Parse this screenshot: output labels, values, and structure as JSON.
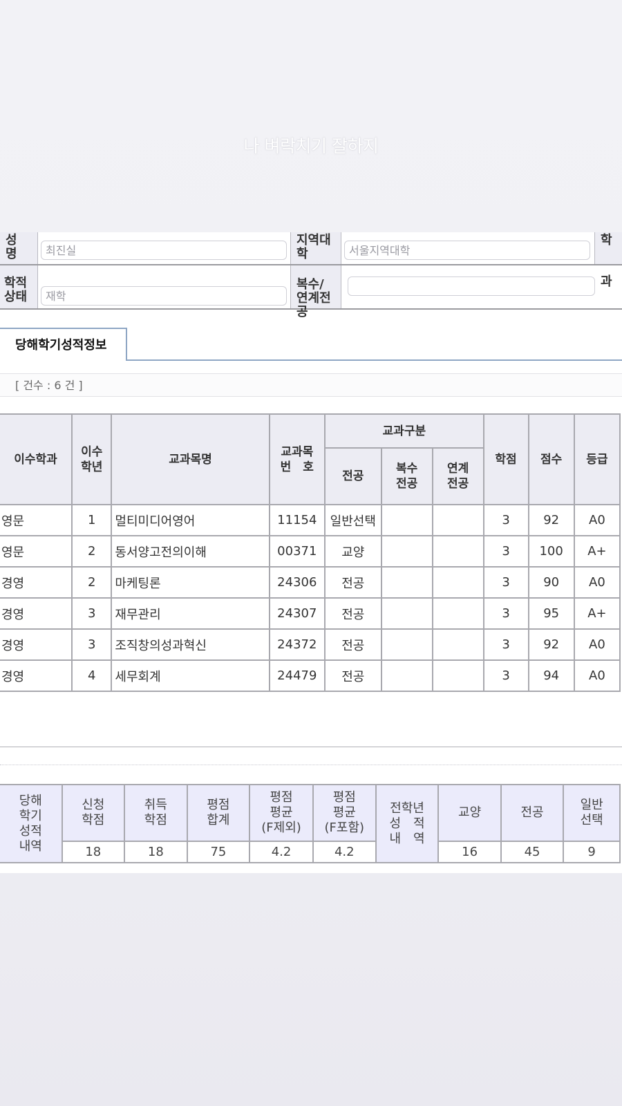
{
  "overlay_text": "나 벼락치기 잘하지",
  "student_info": {
    "name_label": "성\n명",
    "name_value": "최진실",
    "region_label": "지역대\n학",
    "region_value": "서울지역대학",
    "dept_label": "학",
    "status_label": "학적\n상태",
    "status_value": "재학",
    "double_major_label": "복수/\n연계전\n공",
    "double_major_value": "",
    "course_label": "과"
  },
  "tab": {
    "label": "당해학기성적정보"
  },
  "count_text": "[ 건수 : 6 건 ]",
  "grades_table": {
    "headers": {
      "dept": "이수학과",
      "year": "이수\n학년",
      "course_name": "교과목명",
      "course_no": "교과목\n번　호",
      "category_group": "교과구분",
      "major": "전공",
      "double_major": "복수\n전공",
      "linked_major": "연계\n전공",
      "credit": "학점",
      "score": "점수",
      "grade": "등급"
    },
    "rows": [
      {
        "dept": "영문",
        "year": "1",
        "name": "멀티미디어영어",
        "no": "11154",
        "major": "일반선택",
        "double": "",
        "linked": "",
        "credit": "3",
        "score": "92",
        "grade": "A0"
      },
      {
        "dept": "영문",
        "year": "2",
        "name": "동서양고전의이해",
        "no": "00371",
        "major": "교양",
        "double": "",
        "linked": "",
        "credit": "3",
        "score": "100",
        "grade": "A+"
      },
      {
        "dept": "경영",
        "year": "2",
        "name": "마케팅론",
        "no": "24306",
        "major": "전공",
        "double": "",
        "linked": "",
        "credit": "3",
        "score": "90",
        "grade": "A0"
      },
      {
        "dept": "경영",
        "year": "3",
        "name": "재무관리",
        "no": "24307",
        "major": "전공",
        "double": "",
        "linked": "",
        "credit": "3",
        "score": "95",
        "grade": "A+"
      },
      {
        "dept": "경영",
        "year": "3",
        "name": "조직창의성과혁신",
        "no": "24372",
        "major": "전공",
        "double": "",
        "linked": "",
        "credit": "3",
        "score": "92",
        "grade": "A0"
      },
      {
        "dept": "경영",
        "year": "4",
        "name": "세무회계",
        "no": "24479",
        "major": "전공",
        "double": "",
        "linked": "",
        "credit": "3",
        "score": "94",
        "grade": "A0"
      }
    ]
  },
  "summary": {
    "title": "당해\n학기\n성적\n내역",
    "applied_label": "신청\n학점",
    "applied_value": "18",
    "earned_label": "취득\n학점",
    "earned_value": "18",
    "total_label": "평점\n합계",
    "total_value": "75",
    "avg_excl_label": "평점\n평균\n(F제외)",
    "avg_excl_value": "4.2",
    "avg_incl_label": "평점\n평균\n(F포함)",
    "avg_incl_value": "4.2",
    "all_years_label": "전학년\n성　적\n내　역",
    "general_label": "교양",
    "general_value": "16",
    "major_label": "전공",
    "major_value": "45",
    "elective_label": "일반\n선택",
    "elective_value": "9"
  }
}
